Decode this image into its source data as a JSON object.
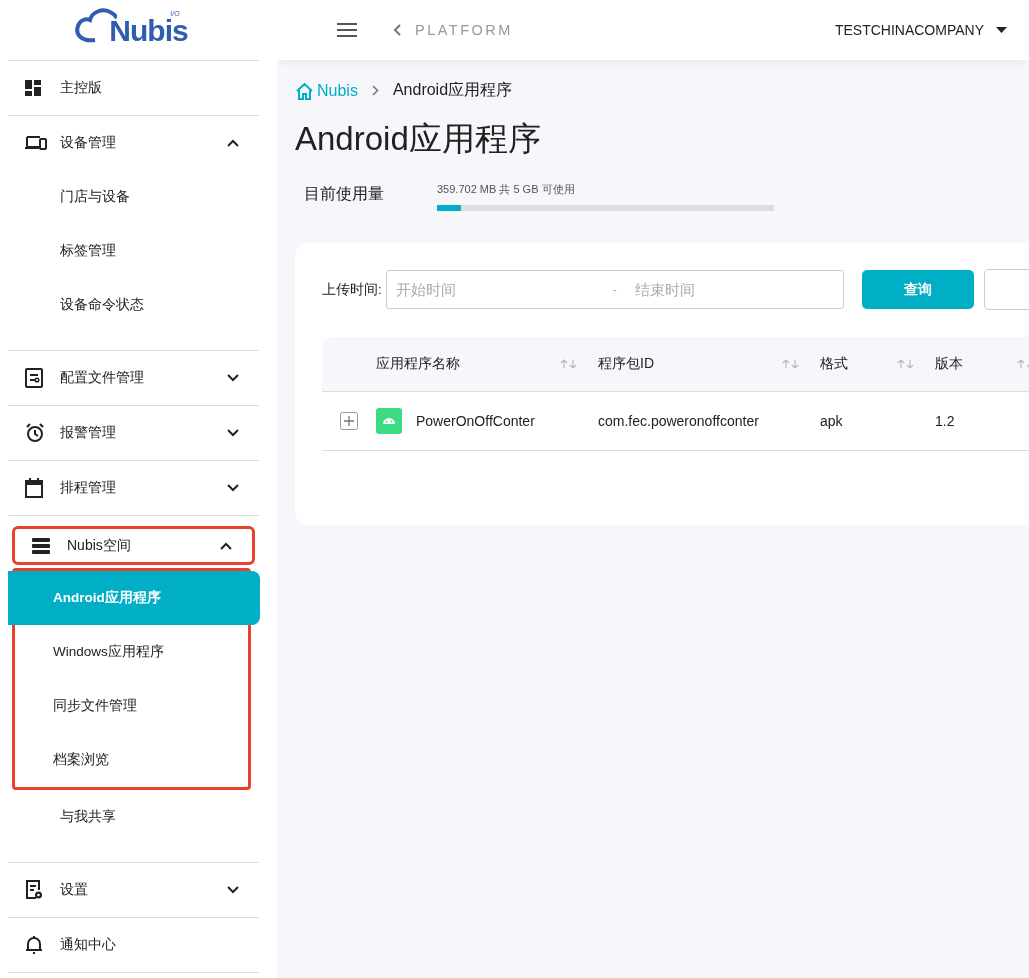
{
  "logo": {
    "text": "Nubis",
    "superscript": "I/O"
  },
  "sidebar": {
    "items": [
      {
        "kind": "link",
        "label": "主控版"
      },
      {
        "kind": "group",
        "label": "设备管理",
        "expanded": true,
        "highlighted": false,
        "children": [
          {
            "label": "门店与设备",
            "selected": false,
            "highlighted": false
          },
          {
            "label": "标签管理",
            "selected": false,
            "highlighted": false
          },
          {
            "label": "设备命令状态",
            "selected": false,
            "highlighted": false
          }
        ]
      },
      {
        "kind": "group",
        "label": "配置文件管理",
        "expanded": false,
        "highlighted": false
      },
      {
        "kind": "group",
        "label": "报警管理",
        "expanded": false,
        "highlighted": false
      },
      {
        "kind": "group",
        "label": "排程管理",
        "expanded": false,
        "highlighted": false
      },
      {
        "kind": "group",
        "label": "Nubis空间",
        "expanded": true,
        "highlighted": true,
        "children": [
          {
            "label": "Android应用程序",
            "selected": true,
            "highlighted": true
          },
          {
            "label": "Windows应用程序",
            "selected": false,
            "highlighted": true
          },
          {
            "label": "同步文件管理",
            "selected": false,
            "highlighted": true
          },
          {
            "label": "档案浏览",
            "selected": false,
            "highlighted": true
          },
          {
            "label": "与我共享",
            "selected": false,
            "highlighted": false
          }
        ]
      },
      {
        "kind": "group",
        "label": "设置",
        "expanded": false,
        "highlighted": false
      },
      {
        "kind": "link",
        "label": "通知中心"
      }
    ]
  },
  "topbar": {
    "back_label": "PLATFORM",
    "company": "TESTCHINACOMPANY"
  },
  "breadcrumb": [
    "Nubis",
    "Android应用程序"
  ],
  "page_title": "Android应用程序",
  "usage": {
    "label": "目前使用量",
    "reading": "359.702 MB 共 5 GB 可使用",
    "level": 0.07
  },
  "filter": {
    "label": "上传时间:",
    "start_placeholder": "开始时间",
    "separator": "-",
    "end_placeholder": "结束时间",
    "query_button": "查询"
  },
  "table": {
    "columns": [
      "应用程序名称",
      "程序包ID",
      "格式",
      "版本"
    ],
    "rows": [
      {
        "name": "PowerOnOffConter",
        "package_id": "com.fec.poweronoffconter",
        "format": "apk",
        "version": "1.2"
      }
    ]
  }
}
